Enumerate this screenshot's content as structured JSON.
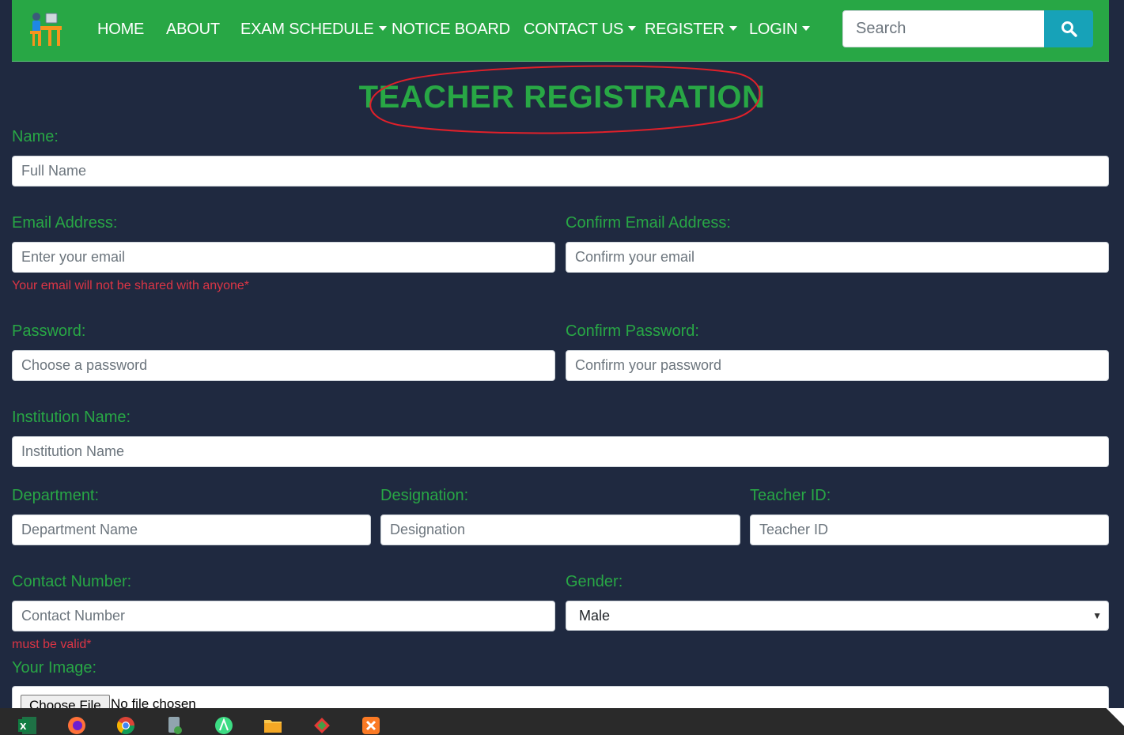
{
  "nav": {
    "items": [
      {
        "label": "HOME",
        "dropdown": false
      },
      {
        "label": "ABOUT",
        "dropdown": false
      },
      {
        "label": "EXAM SCHEDULE",
        "dropdown": true
      },
      {
        "label": "NOTICE BOARD",
        "dropdown": false
      },
      {
        "label": "CONTACT US",
        "dropdown": true
      },
      {
        "label": "REGISTER",
        "dropdown": true
      },
      {
        "label": "LOGIN",
        "dropdown": true
      }
    ],
    "search_placeholder": "Search"
  },
  "title": "TEACHER REGISTRATION",
  "form": {
    "name": {
      "label": "Name:",
      "placeholder": "Full Name"
    },
    "email": {
      "label": "Email Address:",
      "placeholder": "Enter your email",
      "help": "Your email will not be shared with anyone*"
    },
    "confirm_email": {
      "label": "Confirm Email Address:",
      "placeholder": "Confirm your email"
    },
    "password": {
      "label": "Password:",
      "placeholder": "Choose a password"
    },
    "confirm_password": {
      "label": "Confirm Password:",
      "placeholder": "Confirm your password"
    },
    "institution": {
      "label": "Institution Name:",
      "placeholder": "Institution Name"
    },
    "department": {
      "label": "Department:",
      "placeholder": "Department Name"
    },
    "designation": {
      "label": "Designation:",
      "placeholder": "Designation"
    },
    "teacher_id": {
      "label": "Teacher ID:",
      "placeholder": "Teacher ID"
    },
    "contact": {
      "label": "Contact Number:",
      "placeholder": "Contact Number",
      "help": "must be valid*"
    },
    "gender": {
      "label": "Gender:",
      "value": "Male"
    },
    "image": {
      "label": "Your Image:",
      "button": "Choose File",
      "status": "No file chosen"
    }
  },
  "colors": {
    "background": "#1f2940",
    "navbar": "#28a745",
    "accent_green": "#28a745",
    "search_button": "#17a2b8",
    "help_text": "#dc3545",
    "annotation_circle": "#e0202a"
  },
  "taskbar": {
    "icons": [
      "excel-icon",
      "firefox-icon",
      "chrome-icon",
      "file-manager-icon",
      "android-studio-icon",
      "folder-icon",
      "git-tool-icon",
      "xampp-icon"
    ]
  }
}
